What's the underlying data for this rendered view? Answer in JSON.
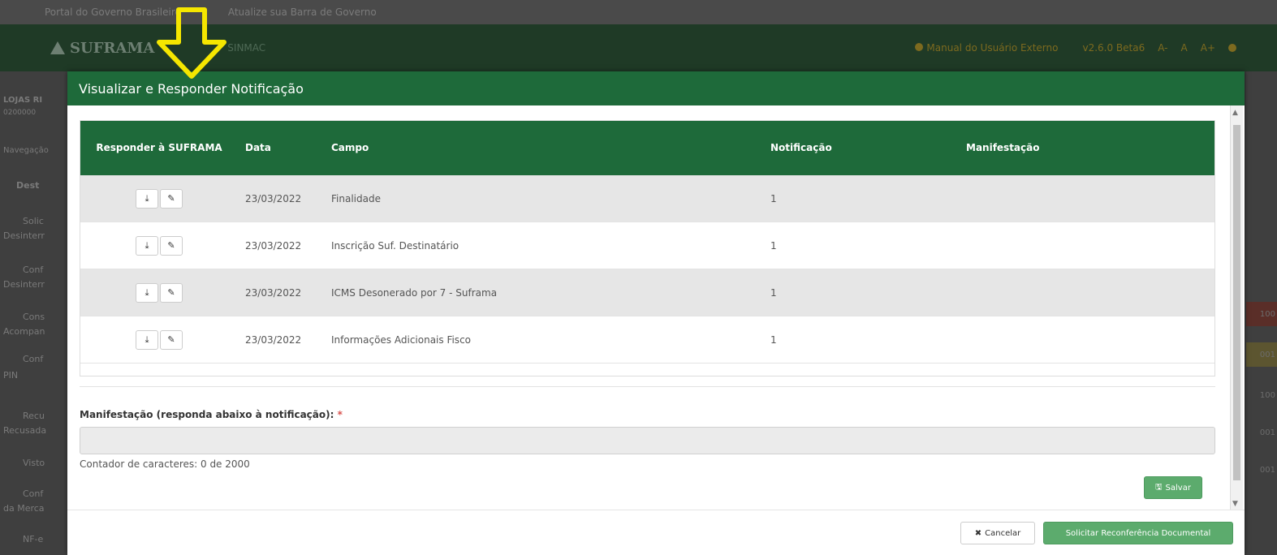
{
  "background": {
    "gov_bar": [
      "Portal do Governo Brasileiro",
      "Atualize sua Barra de Governo"
    ],
    "logo_text": "SUFRAMA",
    "subsystem": "SINMAC",
    "manual_link": "Manual do Usuário Externo",
    "version": "v2.6.0 Beta6",
    "font_controls": [
      "A-",
      "A",
      "A+"
    ],
    "user_short": "LOJAS RI",
    "user_code": "0200000",
    "nav_label": "Navegação",
    "side_items": [
      "Dest",
      "Solic",
      "Desinterr",
      "Conf",
      "Desinterr",
      "Cons",
      "Acompan",
      "Conf",
      "PIN",
      "Recu",
      "Recusada",
      "Visto",
      "Conf",
      "da Merca",
      "NF-e"
    ],
    "right_chips": [
      "100",
      "001",
      "100",
      "001",
      "001"
    ]
  },
  "modal": {
    "title": "Visualizar e Responder Notificação",
    "table": {
      "headers": {
        "responder": "Responder à SUFRAMA",
        "data": "Data",
        "campo": "Campo",
        "notificacao": "Notificação",
        "manifestacao": "Manifestação"
      },
      "rows": [
        {
          "data": "23/03/2022",
          "campo": "Finalidade",
          "notificacao": "1",
          "manifestacao": ""
        },
        {
          "data": "23/03/2022",
          "campo": "Inscrição Suf. Destinatário",
          "notificacao": "1",
          "manifestacao": ""
        },
        {
          "data": "23/03/2022",
          "campo": "ICMS Desonerado por 7 - Suframa",
          "notificacao": "1",
          "manifestacao": ""
        },
        {
          "data": "23/03/2022",
          "campo": "Informações Adicionais Fisco",
          "notificacao": "1",
          "manifestacao": ""
        }
      ],
      "download_icon": "download-icon",
      "edit_icon": "edit-icon"
    },
    "manifest_label": "Manifestação (responda abaixo à notificação):",
    "required_mark": "*",
    "manifest_value": "",
    "counter": "Contador de caracteres: 0 de 2000",
    "save_label": "Salvar",
    "cancel_label": "Cancelar",
    "recon_label": "Solicitar Reconferência Documental"
  },
  "colors": {
    "header_green": "#1e6a3a",
    "button_green": "#5cab6d",
    "arrow_yellow": "#f5e600"
  }
}
